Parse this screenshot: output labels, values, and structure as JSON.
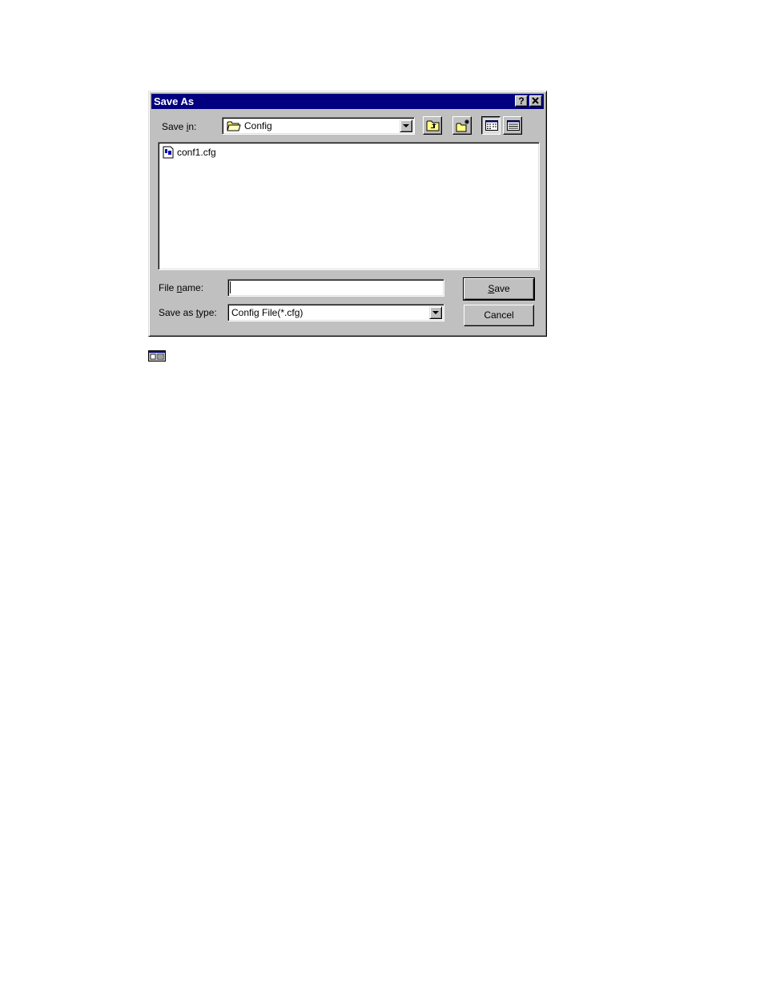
{
  "dialog": {
    "title": "Save As",
    "help_glyph": "?",
    "close_glyph": "✕",
    "save_in": {
      "label_pre": "Save ",
      "label_accel": "i",
      "label_post": "n:",
      "value": "Config",
      "icon": "folder-icon"
    },
    "toolbar": {
      "up_folder_icon": "up-one-level-icon",
      "new_folder_icon": "create-new-folder-icon",
      "list_view_icon": "list-view-icon",
      "details_view_icon": "details-view-icon"
    },
    "files": [
      {
        "name": "conf1.cfg",
        "icon": "config-file-icon"
      }
    ],
    "file_name": {
      "label_pre": "File ",
      "label_accel": "n",
      "label_post": "ame:",
      "value": ""
    },
    "save_as_type": {
      "label_pre": "Save as ",
      "label_accel": "t",
      "label_post": "ype:",
      "value": "Config File(*.cfg)"
    },
    "save_button": {
      "accel": "S",
      "rest": "ave"
    },
    "cancel_button": "Cancel"
  },
  "footer": {
    "icon": "dialog-window-icon"
  },
  "colors": {
    "title_bar": "#000080",
    "face": "#c0c0c0",
    "folder": "#ffff80"
  }
}
